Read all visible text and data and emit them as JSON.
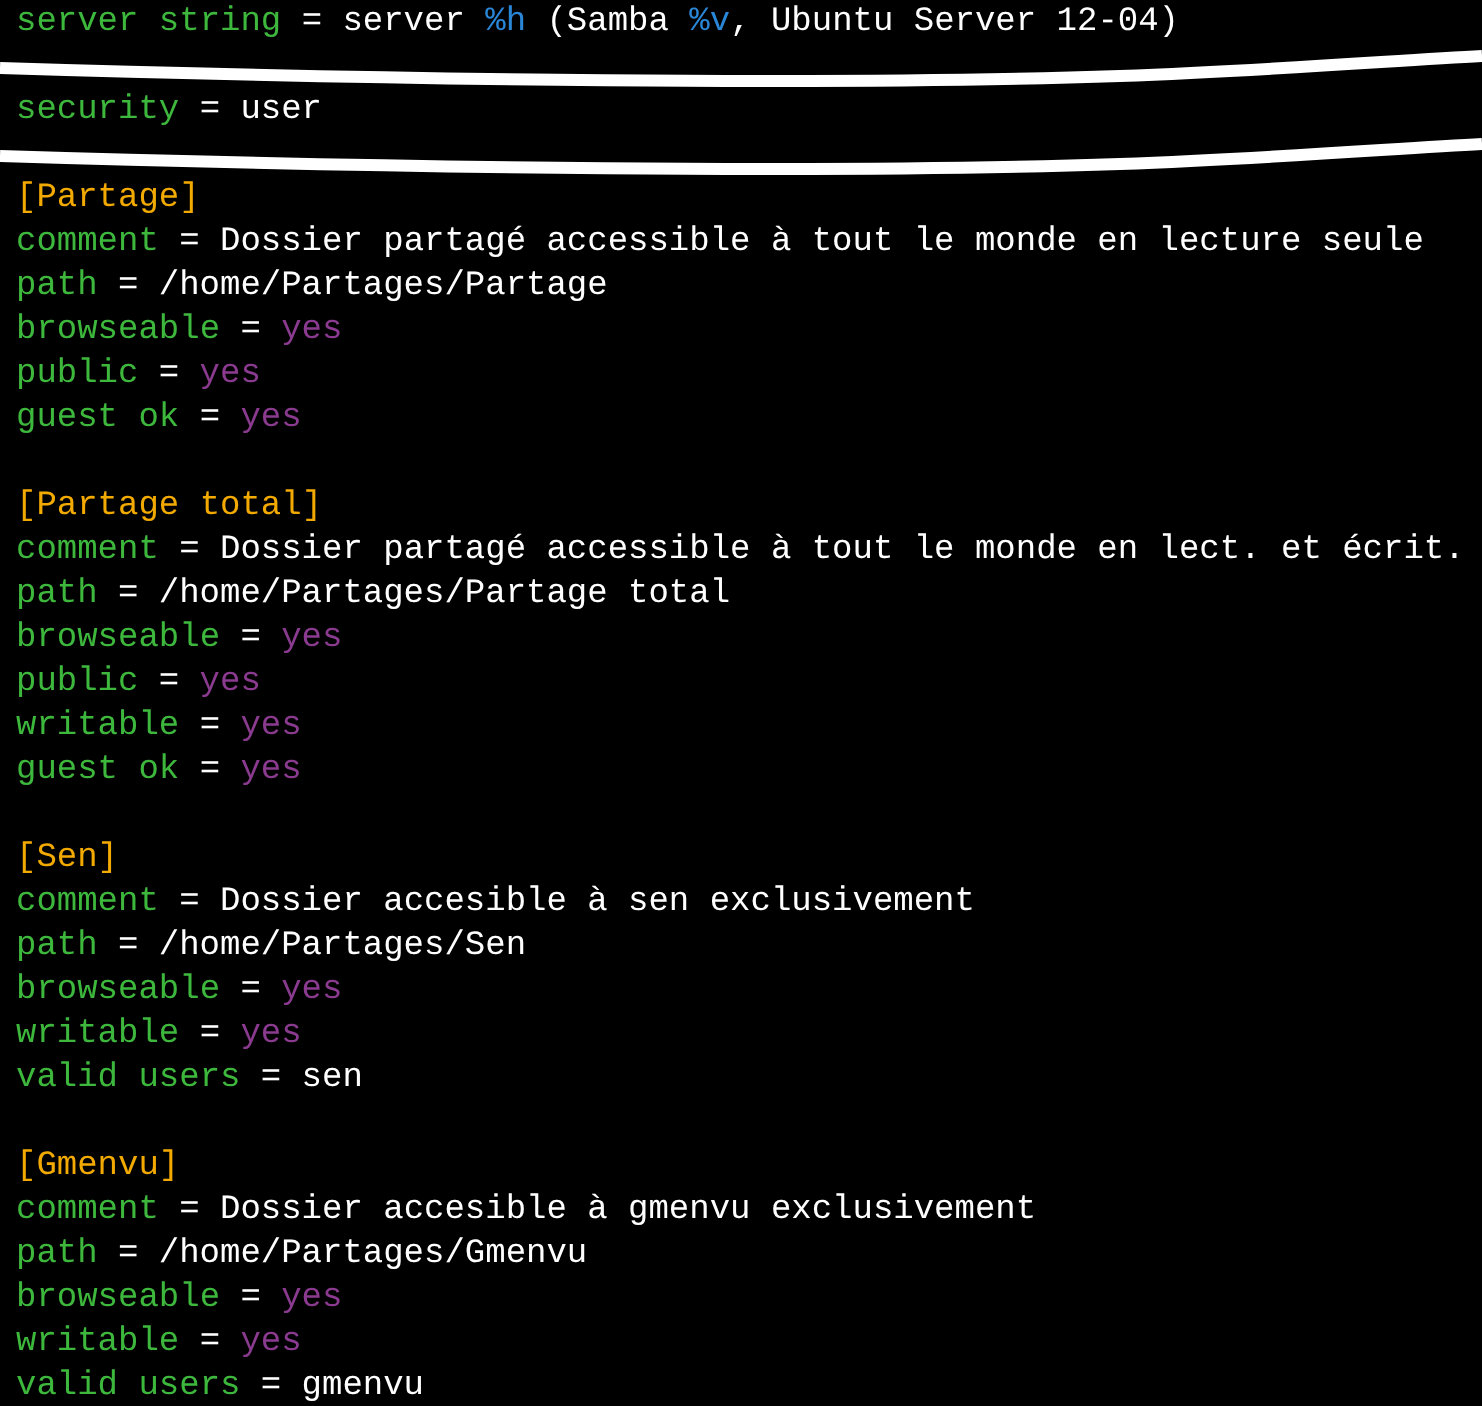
{
  "blocks": [
    {
      "sections": [
        {
          "lines": [
            {
              "tokens": [
                {
                  "kind": "key",
                  "text": "server string"
                },
                {
                  "kind": "op",
                  "text": "="
                },
                {
                  "kind": "value",
                  "text": "server "
                },
                {
                  "kind": "variable",
                  "text": "%h"
                },
                {
                  "kind": "value",
                  "text": " (Samba "
                },
                {
                  "kind": "variable",
                  "text": "%v"
                },
                {
                  "kind": "value",
                  "text": ", Ubuntu Server 12-04)"
                }
              ]
            }
          ]
        }
      ]
    },
    {
      "sections": [
        {
          "lines": [
            {
              "tokens": [
                {
                  "kind": "key",
                  "text": "security"
                },
                {
                  "kind": "op",
                  "text": "="
                },
                {
                  "kind": "value",
                  "text": "user"
                }
              ]
            }
          ]
        }
      ]
    },
    {
      "sections": [
        {
          "lines": [
            {
              "tokens": [
                {
                  "kind": "section",
                  "text": "[Partage]"
                }
              ]
            },
            {
              "tokens": [
                {
                  "kind": "key",
                  "text": "comment"
                },
                {
                  "kind": "op",
                  "text": "="
                },
                {
                  "kind": "value",
                  "text": "Dossier partagé accessible à tout le monde en lecture seule"
                }
              ]
            },
            {
              "tokens": [
                {
                  "kind": "key",
                  "text": "path"
                },
                {
                  "kind": "op",
                  "text": "="
                },
                {
                  "kind": "value",
                  "text": "/home/Partages/Partage"
                }
              ]
            },
            {
              "tokens": [
                {
                  "kind": "key",
                  "text": "browseable"
                },
                {
                  "kind": "op",
                  "text": "="
                },
                {
                  "kind": "boolean",
                  "text": "yes"
                }
              ]
            },
            {
              "tokens": [
                {
                  "kind": "key",
                  "text": "public"
                },
                {
                  "kind": "op",
                  "text": "="
                },
                {
                  "kind": "boolean",
                  "text": "yes"
                }
              ]
            },
            {
              "tokens": [
                {
                  "kind": "key",
                  "text": "guest ok"
                },
                {
                  "kind": "op",
                  "text": "="
                },
                {
                  "kind": "boolean",
                  "text": "yes"
                }
              ]
            }
          ]
        },
        {
          "lines": [
            {
              "tokens": [
                {
                  "kind": "section",
                  "text": "[Partage total]"
                }
              ]
            },
            {
              "tokens": [
                {
                  "kind": "key",
                  "text": "comment"
                },
                {
                  "kind": "op",
                  "text": "="
                },
                {
                  "kind": "value",
                  "text": "Dossier partagé accessible à tout le monde en lect. et écrit."
                }
              ]
            },
            {
              "tokens": [
                {
                  "kind": "key",
                  "text": "path"
                },
                {
                  "kind": "op",
                  "text": "="
                },
                {
                  "kind": "value",
                  "text": "/home/Partages/Partage total"
                }
              ]
            },
            {
              "tokens": [
                {
                  "kind": "key",
                  "text": "browseable"
                },
                {
                  "kind": "op",
                  "text": "="
                },
                {
                  "kind": "boolean",
                  "text": "yes"
                }
              ]
            },
            {
              "tokens": [
                {
                  "kind": "key",
                  "text": "public"
                },
                {
                  "kind": "op",
                  "text": "="
                },
                {
                  "kind": "boolean",
                  "text": "yes"
                }
              ]
            },
            {
              "tokens": [
                {
                  "kind": "key",
                  "text": "writable"
                },
                {
                  "kind": "op",
                  "text": "="
                },
                {
                  "kind": "boolean",
                  "text": "yes"
                }
              ]
            },
            {
              "tokens": [
                {
                  "kind": "key",
                  "text": "guest ok"
                },
                {
                  "kind": "op",
                  "text": "="
                },
                {
                  "kind": "boolean",
                  "text": "yes"
                }
              ]
            }
          ]
        },
        {
          "lines": [
            {
              "tokens": [
                {
                  "kind": "section",
                  "text": "[Sen]"
                }
              ]
            },
            {
              "tokens": [
                {
                  "kind": "key",
                  "text": "comment"
                },
                {
                  "kind": "op",
                  "text": "="
                },
                {
                  "kind": "value",
                  "text": "Dossier accesible à sen exclusivement"
                }
              ]
            },
            {
              "tokens": [
                {
                  "kind": "key",
                  "text": "path"
                },
                {
                  "kind": "op",
                  "text": "="
                },
                {
                  "kind": "value",
                  "text": "/home/Partages/Sen"
                }
              ]
            },
            {
              "tokens": [
                {
                  "kind": "key",
                  "text": "browseable"
                },
                {
                  "kind": "op",
                  "text": "="
                },
                {
                  "kind": "boolean",
                  "text": "yes"
                }
              ]
            },
            {
              "tokens": [
                {
                  "kind": "key",
                  "text": "writable"
                },
                {
                  "kind": "op",
                  "text": "="
                },
                {
                  "kind": "boolean",
                  "text": "yes"
                }
              ]
            },
            {
              "tokens": [
                {
                  "kind": "key",
                  "text": "valid users"
                },
                {
                  "kind": "op",
                  "text": "="
                },
                {
                  "kind": "value",
                  "text": "sen"
                }
              ]
            }
          ]
        },
        {
          "lines": [
            {
              "tokens": [
                {
                  "kind": "section",
                  "text": "[Gmenvu]"
                }
              ]
            },
            {
              "tokens": [
                {
                  "kind": "key",
                  "text": "comment"
                },
                {
                  "kind": "op",
                  "text": "="
                },
                {
                  "kind": "value",
                  "text": "Dossier accesible à gmenvu exclusivement"
                }
              ]
            },
            {
              "tokens": [
                {
                  "kind": "key",
                  "text": "path"
                },
                {
                  "kind": "op",
                  "text": "="
                },
                {
                  "kind": "value",
                  "text": "/home/Partages/Gmenvu"
                }
              ]
            },
            {
              "tokens": [
                {
                  "kind": "key",
                  "text": "browseable"
                },
                {
                  "kind": "op",
                  "text": "="
                },
                {
                  "kind": "boolean",
                  "text": "yes"
                }
              ]
            },
            {
              "tokens": [
                {
                  "kind": "key",
                  "text": "writable"
                },
                {
                  "kind": "op",
                  "text": "="
                },
                {
                  "kind": "boolean",
                  "text": "yes"
                }
              ]
            },
            {
              "tokens": [
                {
                  "kind": "key",
                  "text": "valid users"
                },
                {
                  "kind": "op",
                  "text": "="
                },
                {
                  "kind": "value",
                  "text": "gmenvu"
                }
              ]
            }
          ]
        }
      ]
    }
  ]
}
